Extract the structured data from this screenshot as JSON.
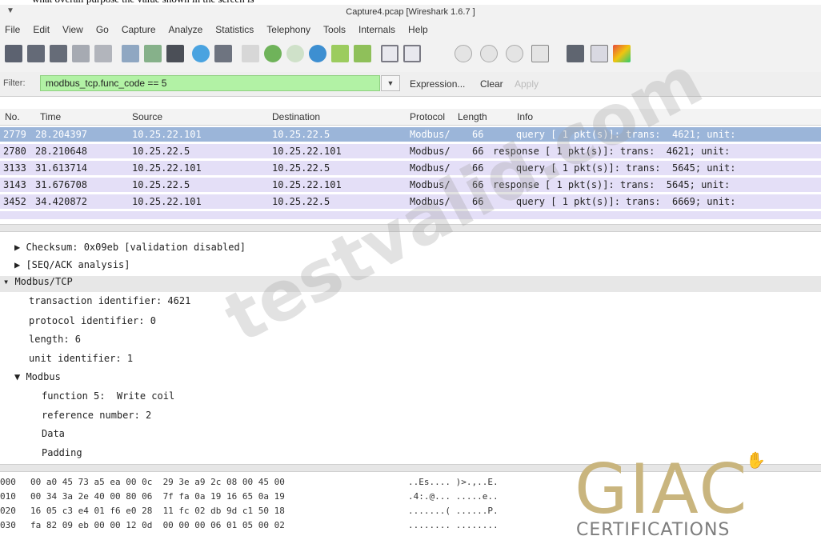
{
  "window": {
    "title": "Capture4.pcap  [Wireshark 1.6.7 ]",
    "menu_glyph": "▼"
  },
  "menu": [
    "File",
    "Edit",
    "View",
    "Go",
    "Capture",
    "Analyze",
    "Statistics",
    "Telephony",
    "Tools",
    "Internals",
    "Help"
  ],
  "toolbar_icons": [
    "interfaces-icon",
    "capture-options-icon",
    "start-capture-icon",
    "stop-capture-icon",
    "restart-capture-icon",
    "open-file-icon",
    "save-file-icon",
    "close-file-icon",
    "reload-icon",
    "print-icon",
    "find-icon",
    "go-back-icon",
    "go-forward-icon",
    "go-to-packet-icon",
    "go-first-icon",
    "go-last-icon",
    "colorize-icon",
    "autoscroll-icon",
    "zoom-in-icon",
    "zoom-out-icon",
    "zoom-normal-icon",
    "resize-columns-icon",
    "capture-filters-icon",
    "display-filters-icon",
    "coloring-rules-icon"
  ],
  "filter": {
    "label": "Filter:",
    "value": "modbus_tcp.func_code == 5",
    "dropdown_glyph": "▼",
    "expression": "Expression...",
    "clear": "Clear",
    "apply": "Apply"
  },
  "packet_list": {
    "headers": [
      "No.",
      "Time",
      "Source",
      "Destination",
      "Protocol",
      "Length",
      "Info"
    ],
    "rows": [
      {
        "no": "2779",
        "time": "28.204397",
        "src": "10.25.22.101",
        "dst": "10.25.22.5",
        "proto": "Modbus/",
        "len": "66",
        "info": "    query [ 1 pkt(s)]: trans:  4621; unit:"
      },
      {
        "no": "2780",
        "time": "28.210648",
        "src": "10.25.22.5",
        "dst": "10.25.22.101",
        "proto": "Modbus/",
        "len": "66",
        "info": "response [ 1 pkt(s)]: trans:  4621; unit:"
      },
      {
        "no": "3133",
        "time": "31.613714",
        "src": "10.25.22.101",
        "dst": "10.25.22.5",
        "proto": "Modbus/",
        "len": "66",
        "info": "    query [ 1 pkt(s)]: trans:  5645; unit:"
      },
      {
        "no": "3143",
        "time": "31.676708",
        "src": "10.25.22.5",
        "dst": "10.25.22.101",
        "proto": "Modbus/",
        "len": "66",
        "info": "response [ 1 pkt(s)]: trans:  5645; unit:"
      },
      {
        "no": "3452",
        "time": "34.420872",
        "src": "10.25.22.101",
        "dst": "10.25.22.5",
        "proto": "Modbus/",
        "len": "66",
        "info": "    query [ 1 pkt(s)]: trans:  6669; unit:"
      }
    ]
  },
  "details": {
    "checksum": "▶ Checksum: 0x09eb [validation disabled]",
    "seq_ack": "▶ [SEQ/ACK analysis]",
    "modbus_tcp": "▾ Modbus/TCP",
    "transaction_id": "transaction identifier: 4621",
    "protocol_id": "protocol identifier: 0",
    "length": "length: 6",
    "unit_id": "unit identifier: 1",
    "modbus": "▼ Modbus",
    "function": "function 5:  Write coil",
    "reference": "reference number: 2",
    "data": "Data",
    "padding": "Padding"
  },
  "hex_dump": [
    {
      "off": "000",
      "hex": "00 a0 45 73 a5 ea 00 0c  29 3e a9 2c 08 00 45 00",
      "ascii": "..Es.... )>.,..E."
    },
    {
      "off": "010",
      "hex": "00 34 3a 2e 40 00 80 06  7f fa 0a 19 16 65 0a 19",
      "ascii": ".4:.@... .....e.."
    },
    {
      "off": "020",
      "hex": "16 05 c3 e4 01 f6 e0 28  11 fc 02 db 9d c1 50 18",
      "ascii": ".......( ......P."
    },
    {
      "off": "030",
      "hex": "fa 82 09 eb 00 00 12 0d  00 00 00 06 01 05 00 02",
      "ascii": "........ ........"
    }
  ],
  "watermark": "testvalid.com",
  "logo": {
    "main": "GIAC",
    "sub": "CERTIFICATIONS"
  }
}
